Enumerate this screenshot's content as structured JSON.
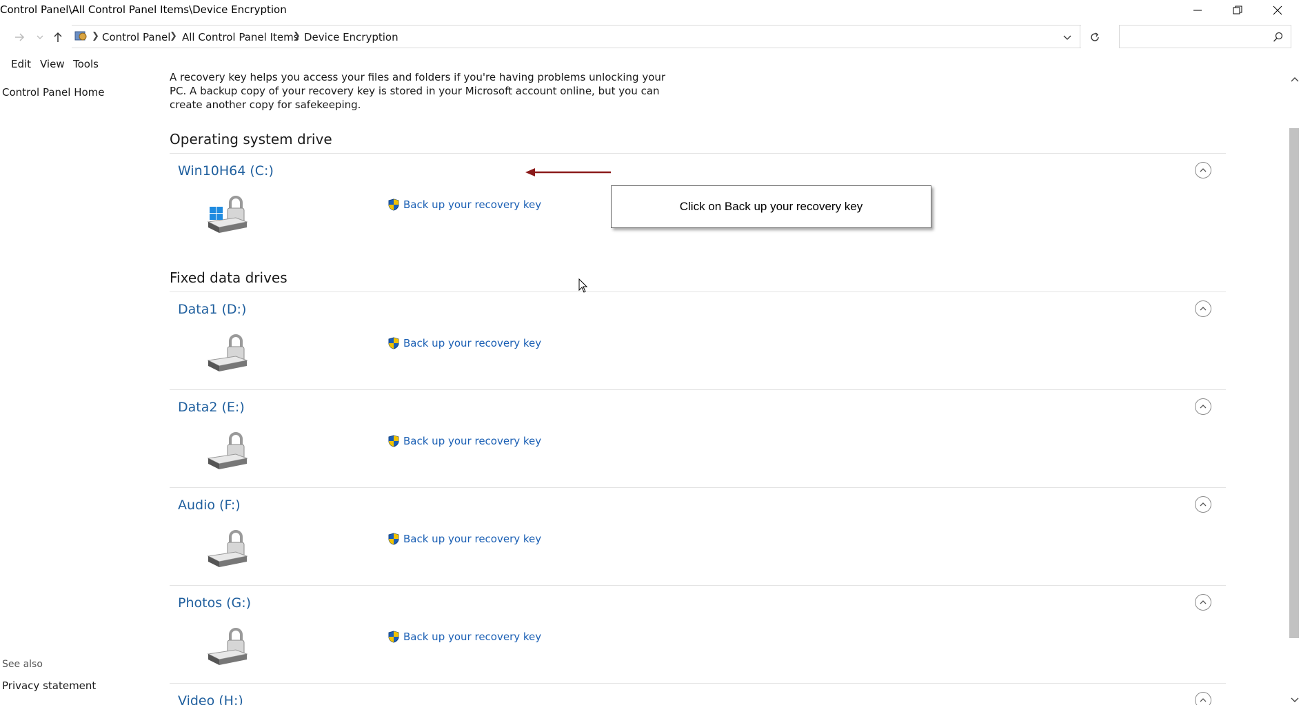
{
  "window": {
    "title": "Control Panel\\All Control Panel Items\\Device Encryption"
  },
  "breadcrumb": [
    "Control Panel",
    "All Control Panel Items",
    "Device Encryption"
  ],
  "search": {
    "placeholder": ""
  },
  "menu": [
    "Edit",
    "View",
    "Tools"
  ],
  "left_pane": {
    "home": "Control Panel Home",
    "see_also": "See also",
    "privacy": "Privacy statement"
  },
  "intro_text": "A recovery key helps you access your files and folders if you're having problems unlocking your PC. A backup copy of your recovery key is stored in your Microsoft account online, but you can create another copy for safekeeping.",
  "sections": {
    "os": "Operating system drive",
    "fixed": "Fixed data drives"
  },
  "drives": [
    {
      "name": "Win10H64 (C:)",
      "action": "Back up your recovery key"
    },
    {
      "name": "Data1 (D:)",
      "action": "Back up your recovery key"
    },
    {
      "name": "Data2 (E:)",
      "action": "Back up your recovery key"
    },
    {
      "name": "Audio (F:)",
      "action": "Back up your recovery key"
    },
    {
      "name": "Photos (G:)",
      "action": "Back up your recovery key"
    },
    {
      "name": "Video (H:)",
      "action": ""
    }
  ],
  "callout": {
    "text": "Click on Back up your recovery key"
  },
  "colors": {
    "link": "#1a5fb4",
    "drive_title": "#1f5f9e",
    "arrow": "#8b1a1a"
  }
}
